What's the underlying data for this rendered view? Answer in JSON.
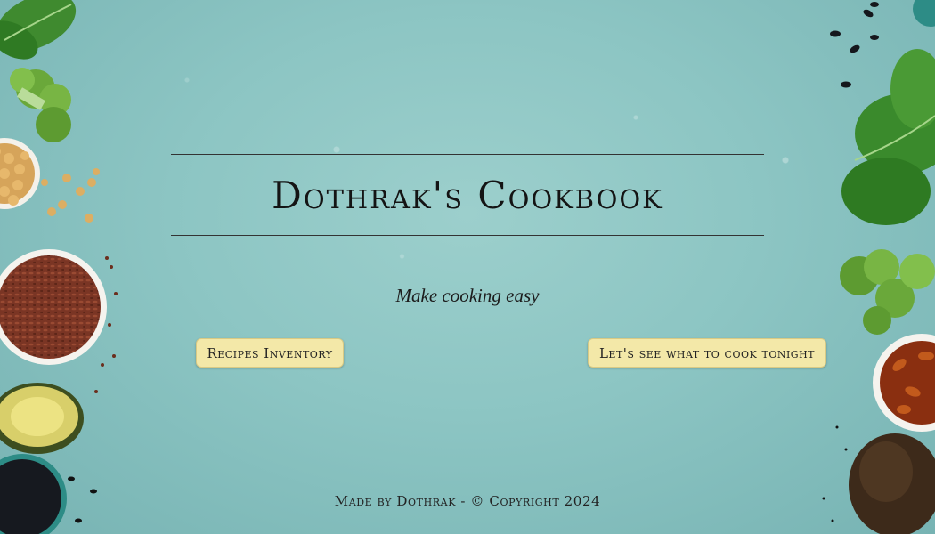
{
  "page": {
    "title": "Dothrak's Cookbook",
    "tagline": "Make cooking easy"
  },
  "actions": {
    "recipes_label": "Recipes Inventory",
    "cook_label": "Let's see what to cook tonight"
  },
  "footer": {
    "text": "Made by Dothrak - © Copyright 2024"
  },
  "colors": {
    "background": "#8cc5c3",
    "button": "#f3e8a8",
    "text": "#141414"
  },
  "decorations": [
    "spinach-leaves",
    "broccoli",
    "chickpeas-bowl",
    "flax-seeds-bowl",
    "avocado-half",
    "black-beans-bowl",
    "raisins-bowl",
    "whole-avocado",
    "black-beans"
  ]
}
